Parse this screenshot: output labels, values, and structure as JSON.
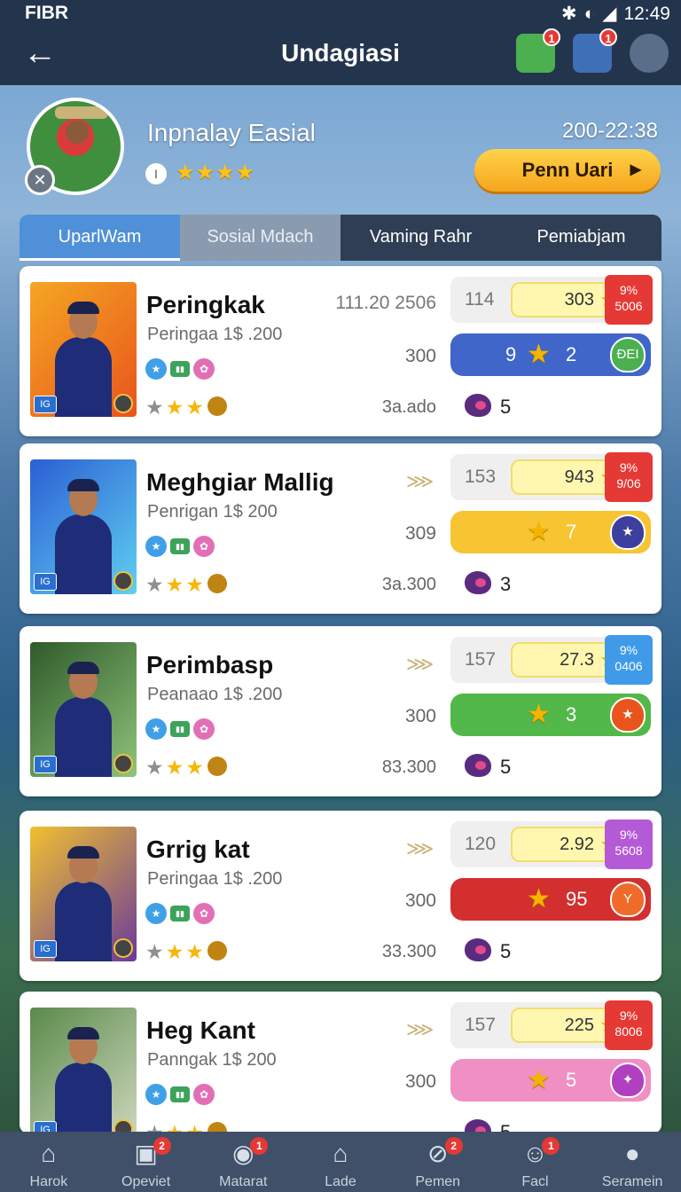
{
  "status_bar": {
    "carrier": "FIBR",
    "time": "12:49"
  },
  "header": {
    "title": "Undagiasi",
    "icons": [
      {
        "name": "play-store-icon",
        "badge": "1",
        "color": "#4caf50"
      },
      {
        "name": "quest-icon",
        "badge": "1",
        "color": "#3f6fb6"
      },
      {
        "name": "profile-avatar-icon",
        "badge": "",
        "color": "#5a6e8a"
      }
    ]
  },
  "profile": {
    "name": "Inpnalay Easial",
    "level": "I",
    "stars": "★★★★",
    "date": "200-22:38",
    "button_label": "Penn Uari"
  },
  "tabs": [
    "UparlWam",
    "Sosial Mdach",
    "Vaming Rahr",
    "Pemiabjam"
  ],
  "players": [
    {
      "name": "Peringkak",
      "sub": "Peringaa 1$ .200",
      "top_value": "111.20 2506",
      "mid_value": "300",
      "bottom_value": "3a.ado",
      "stat_num": "114",
      "stat_val": "303",
      "tag_line1": "9%",
      "tag_line2": "5006",
      "tag_color": "#e53935",
      "pill_v1": "9",
      "pill_v2": "2",
      "pill_color": "#3f66c8",
      "shield_color": "#4caf50",
      "shield_label": "ĐEI",
      "blob_count": "5",
      "bg": "linear-gradient(135deg,#f5a623,#e8541c)"
    },
    {
      "name": "Meghgiar Mallig",
      "sub": "Penrigan 1$ 200",
      "top_value": "",
      "mid_value": "309",
      "bottom_value": "3a.300",
      "stat_num": "153",
      "stat_val": "943",
      "tag_line1": "9%",
      "tag_line2": "9/06",
      "tag_color": "#e53935",
      "pill_v1": "",
      "pill_v2": "7",
      "pill_color": "#f7c531",
      "shield_color": "#3d3f9e",
      "shield_label": "★",
      "blob_count": "3",
      "bg": "linear-gradient(135deg,#2b5fd4,#5fd0f0)"
    },
    {
      "name": "Perimbasp",
      "sub": "Peanaao 1$ .200",
      "top_value": "",
      "mid_value": "300",
      "bottom_value": "83.300",
      "stat_num": "157",
      "stat_val": "27.3",
      "tag_line1": "9%",
      "tag_line2": "0406",
      "tag_color": "#3f9be8",
      "pill_v1": "",
      "pill_v2": "3",
      "pill_color": "#52b84a",
      "shield_color": "#e8541c",
      "shield_label": "★",
      "blob_count": "5",
      "bg": "linear-gradient(135deg,#2f5a2a,#8ec47a)"
    },
    {
      "name": "Grrig kat",
      "sub": "Peringaa 1$ .200",
      "top_value": "",
      "mid_value": "300",
      "bottom_value": "33.300",
      "stat_num": "120",
      "stat_val": "2.92",
      "tag_line1": "9%",
      "tag_line2": "5608",
      "tag_color": "#b45ad6",
      "pill_v1": "",
      "pill_v2": "95",
      "pill_color": "#d32f2f",
      "shield_color": "#f06a2a",
      "shield_label": "Y",
      "blob_count": "5",
      "bg": "linear-gradient(135deg,#f0c030,#6a3a9a)"
    },
    {
      "name": "Heg Kant",
      "sub": "Panngak 1$ 200",
      "top_value": "",
      "mid_value": "300",
      "bottom_value": "",
      "stat_num": "157",
      "stat_val": "225",
      "tag_line1": "9%",
      "tag_line2": "8006",
      "tag_color": "#e53935",
      "pill_v1": "",
      "pill_v2": "5",
      "pill_color": "#ef8fc4",
      "shield_color": "#b040c0",
      "shield_label": "✦",
      "blob_count": "5",
      "bg": "linear-gradient(135deg,#5a8a4a,#d0d8c0)"
    }
  ],
  "bottom_nav": [
    {
      "label": "Harok",
      "icon": "home-icon",
      "badge": ""
    },
    {
      "label": "Opeviet",
      "icon": "gift-icon",
      "badge": "2"
    },
    {
      "label": "Matarat",
      "icon": "chat-icon",
      "badge": "1"
    },
    {
      "label": "Lade",
      "icon": "store-icon",
      "badge": ""
    },
    {
      "label": "Pemen",
      "icon": "compass-icon",
      "badge": "2"
    },
    {
      "label": "Facl",
      "icon": "face-icon",
      "badge": "1"
    },
    {
      "label": "Seramein",
      "icon": "user-icon",
      "badge": ""
    }
  ]
}
